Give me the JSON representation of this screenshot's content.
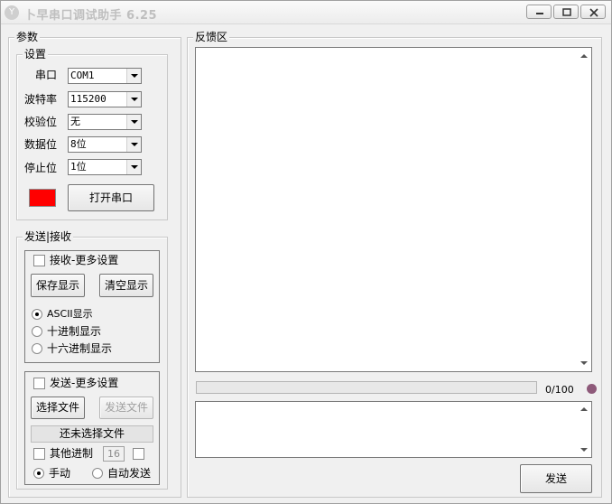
{
  "window": {
    "title": "卜早串口调试助手 6.25",
    "app_icon_glyph": "Y"
  },
  "params": {
    "group_label": "参数",
    "settings": {
      "group_label": "设置",
      "port_label": "串口",
      "port_value": "COM1",
      "baud_label": "波特率",
      "baud_value": "115200",
      "parity_label": "校验位",
      "parity_value": "无",
      "databits_label": "数据位",
      "databits_value": "8位",
      "stopbits_label": "停止位",
      "stopbits_value": "1位",
      "status_color": "#ff0000",
      "open_button": "打开串口"
    }
  },
  "sendrecv": {
    "group_label": "发送|接收",
    "receive": {
      "more_settings_label": "接收-更多设置",
      "save_button": "保存显示",
      "clear_button": "清空显示",
      "display_modes": [
        "ASCII显示",
        "十进制显示",
        "十六进制显示"
      ],
      "selected_mode": "ASCII显示"
    },
    "send": {
      "more_settings_label": "发送-更多设置",
      "choose_file_button": "选择文件",
      "send_file_button": "发送文件",
      "file_status": "还未选择文件",
      "other_base_label": "其他进制",
      "other_base_value": "16",
      "manual_label": "手动",
      "auto_label": "自动发送",
      "selected_send_mode": "手动"
    }
  },
  "feedback": {
    "group_label": "反馈区",
    "progress_text": "0/100",
    "progress_fraction": 0,
    "led_color": "#8e5a7a",
    "send_button": "发送"
  }
}
